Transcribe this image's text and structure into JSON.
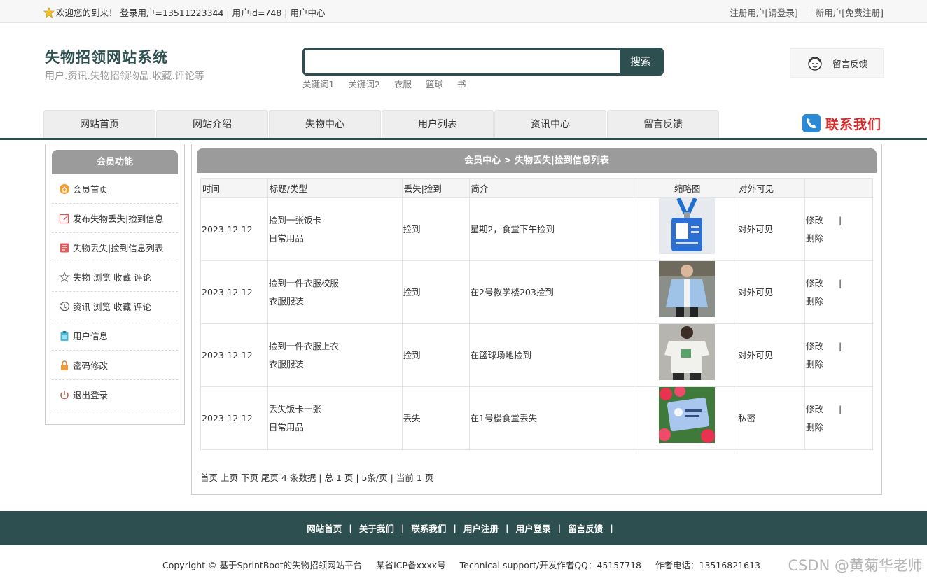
{
  "topbar": {
    "welcome": "欢迎您的到来！ 登录用户=13511223344 | 用户id=748 | 用户中心",
    "register_prefix": "注册用户 ",
    "login_link": "[请登录]",
    "newuser_prefix": "新用户 ",
    "signup_link": "[免费注册]"
  },
  "header": {
    "title": "失物招领网站系统",
    "subtitle": "用户.资讯.失物招领物品.收藏.评论等",
    "search_value": "",
    "search_button": "搜索",
    "hot_words": [
      "关键词1",
      "关键词2",
      "衣服",
      "篮球",
      "书"
    ],
    "feedback": "留言反馈"
  },
  "nav": {
    "tabs": [
      "网站首页",
      "网站介绍",
      "失物中心",
      "用户列表",
      "资讯中心",
      "留言反馈"
    ],
    "contact": "联系我们"
  },
  "sidebar": {
    "title": "会员功能",
    "items": [
      {
        "label": "会员首页",
        "icon": "home-coin-icon"
      },
      {
        "label": "发布失物丢失|捡到信息",
        "icon": "edit-icon"
      },
      {
        "label": "失物丢失|捡到信息列表",
        "icon": "list-icon"
      },
      {
        "label": "失物 浏览 收藏 评论",
        "icon": "star-outline-icon"
      },
      {
        "label": "资讯 浏览 收藏 评论",
        "icon": "history-icon"
      },
      {
        "label": "用户信息",
        "icon": "clipboard-icon"
      },
      {
        "label": "密码修改",
        "icon": "lock-icon"
      },
      {
        "label": "退出登录",
        "icon": "power-icon"
      }
    ]
  },
  "main": {
    "breadcrumb": "会员中心 > 失物丢失|捡到信息列表",
    "columns": [
      "时间",
      "标题/类型",
      "丢失|捡到",
      "简介",
      "缩略图",
      "对外可见",
      ""
    ],
    "rows": [
      {
        "time": "2023-12-12",
        "title": "捡到一张饭卡",
        "category": "日常用品",
        "kind": "捡到",
        "intro": "星期2，食堂下午捡到",
        "thumb": "id-card-photo",
        "visibility": "对外可见"
      },
      {
        "time": "2023-12-12",
        "title": "捡到一件衣服校服",
        "category": "衣服服装",
        "kind": "捡到",
        "intro": "在2号教学楼203捡到",
        "thumb": "jacket-photo",
        "visibility": "对外可见"
      },
      {
        "time": "2023-12-12",
        "title": "捡到一件衣服上衣",
        "category": "衣服服装",
        "kind": "捡到",
        "intro": "在篮球场地捡到",
        "thumb": "tshirt-photo",
        "visibility": "对外可见"
      },
      {
        "time": "2023-12-12",
        "title": "丢失饭卡一张",
        "category": "日常用品",
        "kind": "丢失",
        "intro": "在1号楼食堂丢失",
        "thumb": "card-flowers-photo",
        "visibility": "私密"
      }
    ],
    "edit_label": "修改",
    "divider": "|",
    "delete_label": "删除",
    "pager": "首页 上页 下页 尾页 4 条数据 | 总 1 页 | 5条/页 | 当前 1 页"
  },
  "footer": {
    "links": [
      "网站首页",
      "关于我们",
      "联系我们",
      "用户注册",
      "用户登录",
      "留言反馈"
    ],
    "copyright": "Copyright © 基于SprintBoot的失物招领网站平台",
    "icp": "某省ICP备xxxx号",
    "support": "Technical support/开发作者QQ：45157718",
    "phone": "作者电话：13516821613",
    "watermark": "CSDN @黄菊华老师"
  },
  "colors": {
    "brand_dark": "#2e4f4f",
    "panel_head": "#9b9b9b",
    "contact_red": "#d62a2a"
  }
}
